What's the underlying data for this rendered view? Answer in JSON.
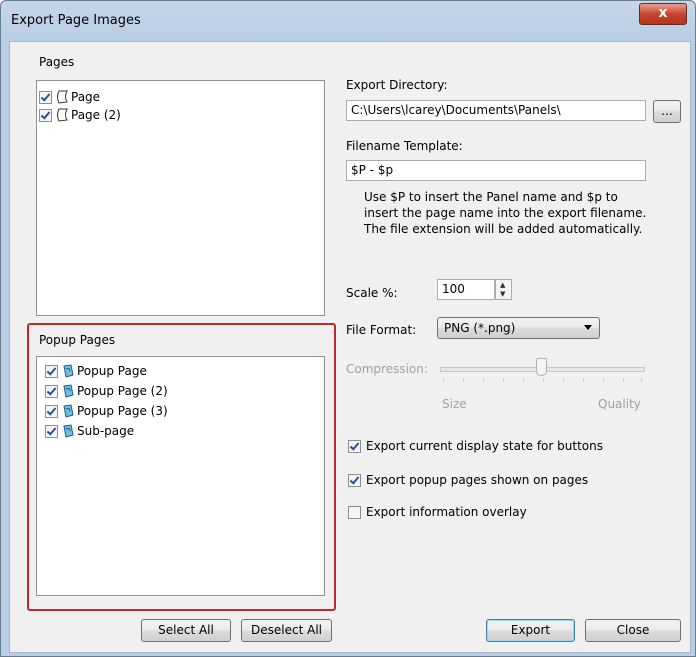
{
  "window": {
    "title": "Export Page Images",
    "close_glyph": "x"
  },
  "pages_group": {
    "label": "Pages",
    "items": [
      {
        "label": "Page",
        "checked": true,
        "icon": "page-icon"
      },
      {
        "label": "Page (2)",
        "checked": true,
        "icon": "page-icon"
      }
    ]
  },
  "popup_group": {
    "label": "Popup Pages",
    "items": [
      {
        "label": "Popup Page",
        "checked": true,
        "icon": "popup-page-icon"
      },
      {
        "label": "Popup Page (2)",
        "checked": true,
        "icon": "popup-page-icon"
      },
      {
        "label": "Popup Page (3)",
        "checked": true,
        "icon": "popup-page-icon"
      },
      {
        "label": "Sub-page",
        "checked": true,
        "icon": "popup-page-icon"
      }
    ]
  },
  "export_directory": {
    "label": "Export Directory:",
    "value": "C:\\Users\\lcarey\\Documents\\Panels\\",
    "browse_label": "..."
  },
  "filename_template": {
    "label": "Filename Template:",
    "value": "$P - $p",
    "help_line1": "Use $P to insert the Panel name and $p to",
    "help_line2": "insert the page name into the export filename.",
    "help_line3": "The file extension will be added automatically."
  },
  "scale": {
    "label": "Scale %:",
    "value": "100"
  },
  "file_format": {
    "label": "File Format:",
    "value": "PNG (*.png)"
  },
  "compression": {
    "label": "Compression:",
    "min_label": "Size",
    "max_label": "Quality",
    "position": 0.5,
    "enabled": false
  },
  "options": {
    "display_state": {
      "label": "Export current display state for buttons",
      "checked": true
    },
    "popup_pages": {
      "label": "Export popup pages shown on pages",
      "checked": true
    },
    "info_overlay": {
      "label": "Export information overlay",
      "checked": false
    }
  },
  "buttons": {
    "select_all": "Select All",
    "deselect_all": "Deselect All",
    "export": "Export",
    "close": "Close"
  },
  "colors": {
    "highlight": "#c0282d",
    "accent": "#2c4f9b",
    "titlebar": "#b9cde4"
  }
}
